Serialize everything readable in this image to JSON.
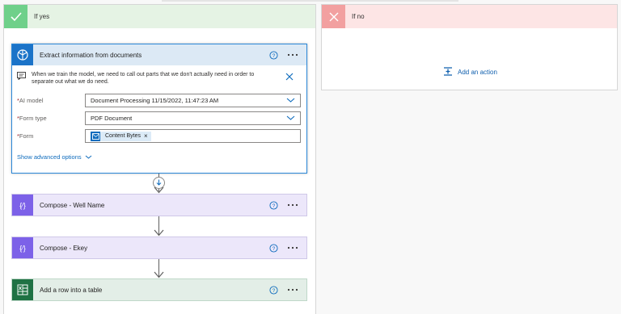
{
  "branch_yes": {
    "title": "If yes"
  },
  "branch_no": {
    "title": "If no",
    "add_action": "Add an action"
  },
  "extract": {
    "title": "Extract information from documents",
    "note": "When we train the model, we need to call out parts that we don't actually need in order to separate out what we do need.",
    "fields": {
      "ai_model": {
        "label": "AI model",
        "value": "Document Processing 11/15/2022, 11:47:23 AM"
      },
      "form_type": {
        "label": "Form type",
        "value": "PDF Document"
      },
      "form": {
        "label": "Form",
        "token": "Content Bytes"
      }
    },
    "advanced": "Show advanced options"
  },
  "compose1": {
    "title": "Compose - Well Name"
  },
  "compose2": {
    "title": "Compose - Ekey"
  },
  "excel": {
    "title": "Add a row into a table"
  },
  "icons": {
    "yes": "check-icon",
    "no": "close-icon",
    "extract": "ai-builder-icon",
    "compose": "compose-braces-icon",
    "excel": "excel-icon",
    "help": "help-circle-icon",
    "more": "more-ellipsis-icon",
    "add": "add-action-icon"
  },
  "colors": {
    "yes_header": "#e5f3e4",
    "no_header": "#fde5e5",
    "ai_builder": "#1b73c8",
    "compose": "#7c61e8",
    "excel": "#1f7244",
    "link": "#0f6cbd"
  }
}
